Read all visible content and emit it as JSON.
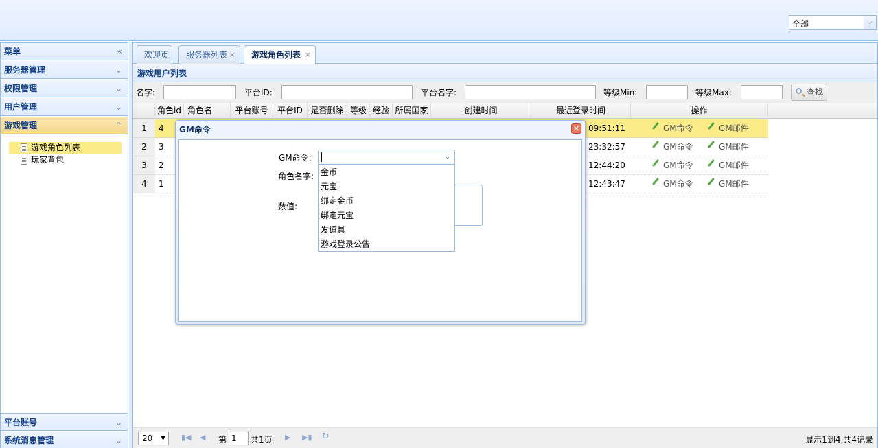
{
  "header": {
    "server_select_value": "全部"
  },
  "sidebar": {
    "menu_title": "菜单",
    "sections": [
      {
        "label": "服务器管理"
      },
      {
        "label": "权限管理"
      },
      {
        "label": "用户管理"
      },
      {
        "label": "游戏管理"
      }
    ],
    "tree_items": [
      {
        "label": "游戏角色列表"
      },
      {
        "label": "玩家背包"
      }
    ],
    "bottom_sections": [
      {
        "label": "平台账号"
      },
      {
        "label": "系统消息管理"
      }
    ]
  },
  "tabs": [
    {
      "label": "欢迎页"
    },
    {
      "label": "服务器列表",
      "close": "×"
    },
    {
      "label": "游戏角色列表",
      "close": "×"
    }
  ],
  "panel": {
    "title": "游戏用户列表"
  },
  "search": {
    "name_label": "名字:",
    "platform_id_label": "平台ID:",
    "platform_name_label": "平台名字:",
    "level_min_label": "等级Min:",
    "level_max_label": "等级Max:",
    "search_button": "查找"
  },
  "grid": {
    "columns": [
      "角色id",
      "角色名",
      "平台账号",
      "平台ID",
      "是否删除",
      "等级",
      "经验",
      "所属国家",
      "创建时间",
      "最近登录时间",
      "操作"
    ],
    "rows": [
      {
        "num": "1",
        "id": "4",
        "last_login": "09:51:11"
      },
      {
        "num": "2",
        "id": "3",
        "last_login": "23:32:57"
      },
      {
        "num": "3",
        "id": "2",
        "last_login": "12:44:20"
      },
      {
        "num": "4",
        "id": "1",
        "last_login": "12:43:47"
      }
    ],
    "op_gm_command": "GM命令",
    "op_gm_mail": "GM邮件"
  },
  "pager": {
    "page_size": "20",
    "page_prefix": "第",
    "page_value": "1",
    "page_suffix": "共1页",
    "info": "显示1到4,共4记录"
  },
  "modal": {
    "title": "GM命令",
    "gm_command_label": "GM命令:",
    "role_name_label": "角色名字:",
    "value_label": "数值:",
    "options": [
      "金币",
      "元宝",
      "绑定金币",
      "绑定元宝",
      "发道具",
      "游戏登录公告"
    ]
  }
}
